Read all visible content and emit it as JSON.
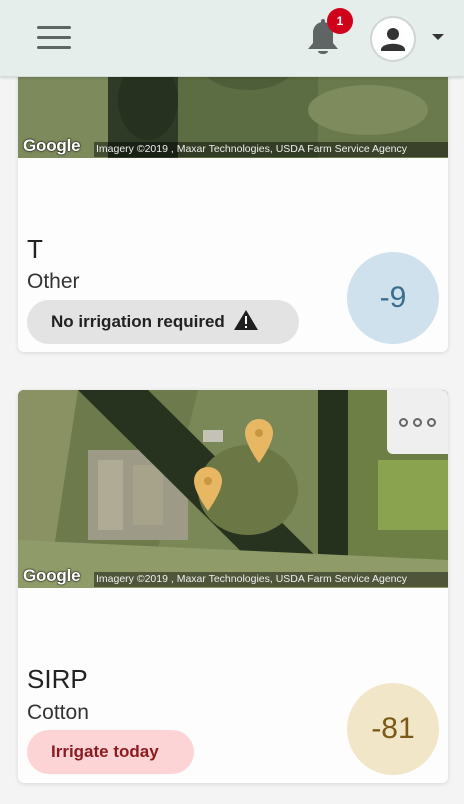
{
  "header": {
    "menu_icon": "hamburger-menu-icon",
    "notification_icon": "bell-icon",
    "notification_count": "1",
    "avatar_icon": "user-avatar-icon",
    "dropdown_icon": "caret-down-icon"
  },
  "fields": [
    {
      "name": "T",
      "crop": "Other",
      "status": "No irrigation required",
      "status_icon": "warning-triangle-icon",
      "score": "-9",
      "map": {
        "logo": "Google",
        "attribution": "Imagery ©2019 , Maxar Technologies, USDA Farm Service Agency"
      }
    },
    {
      "name": "SIRP",
      "crop": "Cotton",
      "status": "Irrigate today",
      "score": "-81",
      "more_icon": "more-options-icon",
      "map": {
        "logo": "Google",
        "attribution": "Imagery ©2019 , Maxar Technologies, USDA Farm Service Agency",
        "marker_icon": "map-pin-icon"
      }
    }
  ],
  "colors": {
    "header_bg": "#e6eeeb",
    "badge": "#d0021b",
    "score_neutral_bg": "#cfe1ec",
    "score_negative_bg": "#f2e6c9",
    "status_alert_bg": "#fcd4d5",
    "marker": "#e8b764"
  }
}
